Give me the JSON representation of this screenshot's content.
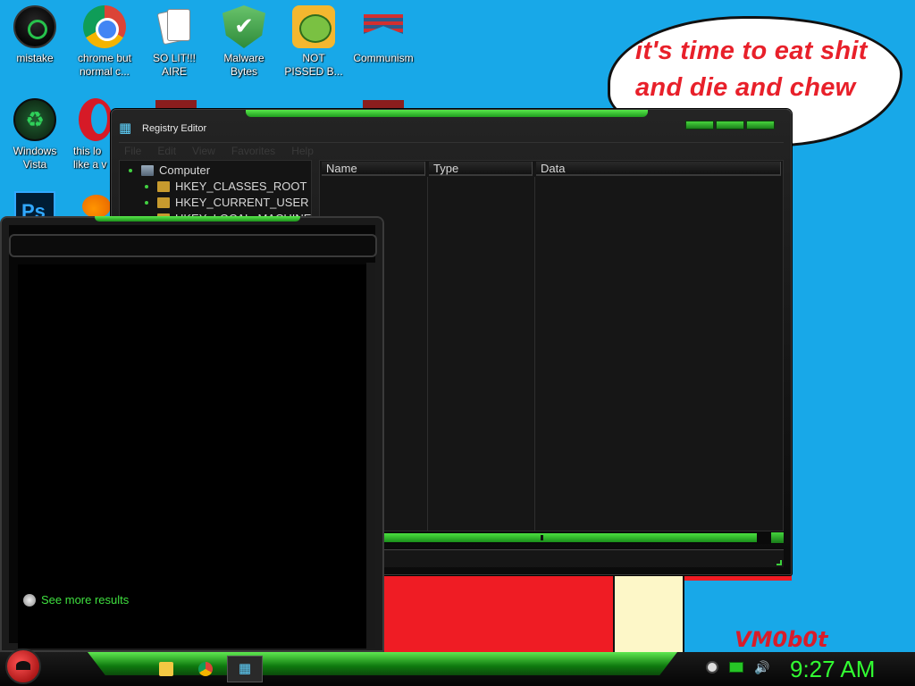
{
  "desktop": {
    "icons": [
      {
        "label": "mistake",
        "icon": "dark-orb-icon"
      },
      {
        "label": "chrome but\nnormal c...",
        "icon": "chrome-icon"
      },
      {
        "label": "SO LIT!!!\nAIRE",
        "icon": "solitaire-cards-icon"
      },
      {
        "label": "Malware\nBytes",
        "icon": "shield-check-icon"
      },
      {
        "label": "NOT\nPISSED B...",
        "icon": "angry-pig-icon"
      },
      {
        "label": "Communism",
        "icon": "flag-emblem-icon"
      },
      {
        "label": "Windows\nVista",
        "icon": "recycle-orb-icon"
      },
      {
        "label": "this lo\nlike a v",
        "icon": "opera-icon"
      }
    ],
    "bubble_lines": [
      "it's time to eat shit",
      "and die and chew"
    ],
    "signature": "VM0b0t"
  },
  "regedit": {
    "title": "Registry Editor",
    "menu": [
      "File",
      "Edit",
      "View",
      "Favorites",
      "Help"
    ],
    "tree": [
      {
        "label": "Computer",
        "icon": "computer-icon"
      },
      {
        "label": "HKEY_CLASSES_ROOT",
        "icon": "folder-icon"
      },
      {
        "label": "HKEY_CURRENT_USER",
        "icon": "folder-icon"
      },
      {
        "label": "HKEY_LOCAL_MACHINE",
        "icon": "folder-icon"
      }
    ],
    "columns": [
      "Name",
      "Type",
      "Data"
    ],
    "status_text": ""
  },
  "start_menu": {
    "search_value": "",
    "see_more": "See more results"
  },
  "taskbar": {
    "pinned": [
      "folder-icon",
      "chrome-icon",
      "regedit-icon"
    ],
    "clock": "9:27 AM"
  },
  "colors": {
    "desktop_bg": "#18a8e8",
    "accent_green": "#32ff32",
    "bubble_text": "#e8202a"
  }
}
